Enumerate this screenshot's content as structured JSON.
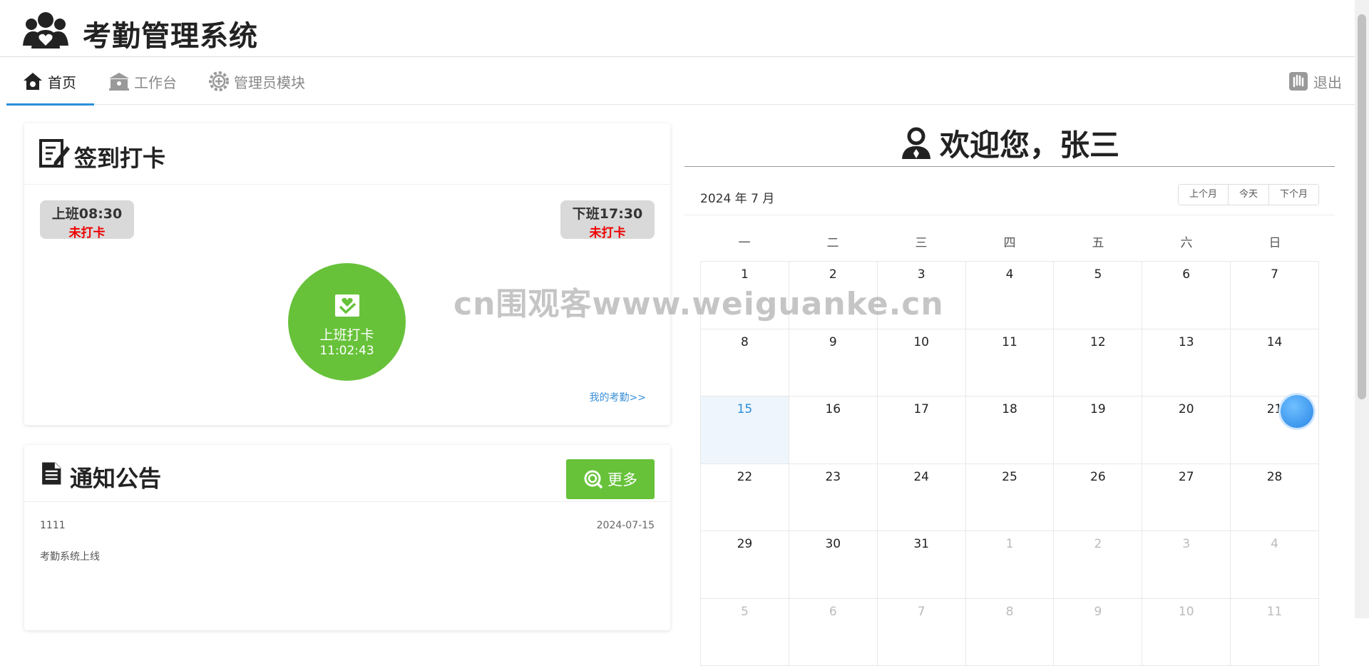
{
  "app": {
    "title": "考勤管理系统"
  },
  "nav": {
    "home": "首页",
    "workbench": "工作台",
    "admin": "管理员模块",
    "logout": "退出"
  },
  "checkin": {
    "title": "签到打卡",
    "on_duty": {
      "time": "上班08:30",
      "status": "未打卡"
    },
    "off_duty": {
      "time": "下班17:30",
      "status": "未打卡"
    },
    "punch": {
      "label": "上班打卡",
      "time": "11:02:43"
    },
    "my_attendance_link": "我的考勤>>"
  },
  "notice": {
    "title": "通知公告",
    "more_button": "更多",
    "item": {
      "title": "1111",
      "date": "2024-07-15",
      "body": "考勤系统上线"
    }
  },
  "welcome": {
    "text": "欢迎您，张三"
  },
  "calendar": {
    "month_label": "2024 年 7 月",
    "buttons": {
      "prev": "上个月",
      "today": "今天",
      "next": "下个月"
    },
    "weekdays": [
      "一",
      "二",
      "三",
      "四",
      "五",
      "六",
      "日"
    ],
    "days": [
      {
        "d": "1"
      },
      {
        "d": "2"
      },
      {
        "d": "3"
      },
      {
        "d": "4"
      },
      {
        "d": "5"
      },
      {
        "d": "6"
      },
      {
        "d": "7"
      },
      {
        "d": "8"
      },
      {
        "d": "9"
      },
      {
        "d": "10"
      },
      {
        "d": "11"
      },
      {
        "d": "12"
      },
      {
        "d": "13"
      },
      {
        "d": "14"
      },
      {
        "d": "15",
        "today": true
      },
      {
        "d": "16"
      },
      {
        "d": "17"
      },
      {
        "d": "18"
      },
      {
        "d": "19"
      },
      {
        "d": "20"
      },
      {
        "d": "21"
      },
      {
        "d": "22"
      },
      {
        "d": "23"
      },
      {
        "d": "24"
      },
      {
        "d": "25"
      },
      {
        "d": "26"
      },
      {
        "d": "27"
      },
      {
        "d": "28"
      },
      {
        "d": "29"
      },
      {
        "d": "30"
      },
      {
        "d": "31"
      },
      {
        "d": "1",
        "other": true
      },
      {
        "d": "2",
        "other": true
      },
      {
        "d": "3",
        "other": true
      },
      {
        "d": "4",
        "other": true
      },
      {
        "d": "5",
        "other": true
      },
      {
        "d": "6",
        "other": true
      },
      {
        "d": "7",
        "other": true
      },
      {
        "d": "8",
        "other": true
      },
      {
        "d": "9",
        "other": true
      },
      {
        "d": "10",
        "other": true
      },
      {
        "d": "11",
        "other": true
      }
    ]
  },
  "watermark": "cn围观客www.weiguanke.cn",
  "colors": {
    "accent": "#67c23a",
    "link": "#2a8fd8",
    "alert": "#ee0000"
  }
}
